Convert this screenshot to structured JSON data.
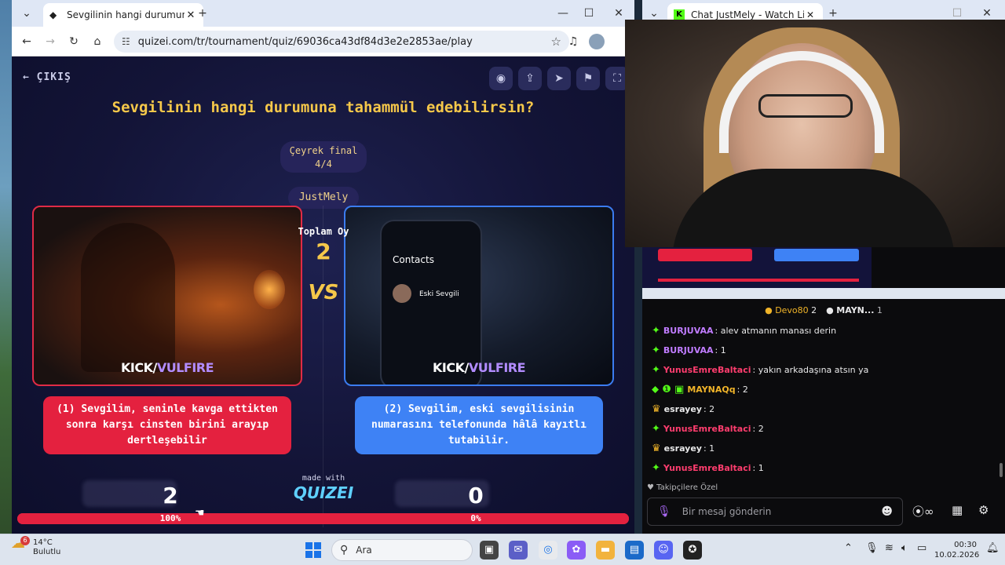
{
  "left_browser": {
    "tab_title": "Sevgilinin hangi durumuna taha",
    "new_tab": "+",
    "url": "quizei.com/tr/tournament/quiz/69036ca43df84d3e2e2853ae/play",
    "window_controls": {
      "min": "—",
      "max": "☐",
      "close": "✕"
    }
  },
  "quiz": {
    "exit_label": "ÇIKIŞ",
    "title": "Sevgilinin hangi durumuna tahammül edebilirsin?",
    "round_name": "Çeyrek final",
    "round_progress": "4/4",
    "player": "JustMely",
    "total_votes_label": "Toplam Oy",
    "total_votes": "2",
    "vs": "VS",
    "left_option": {
      "text": "(1) Sevgilim, seninle kavga ettikten sonra karşı cinsten birini arayıp dertleşebilir",
      "score": "2",
      "percent": "100%",
      "watermark_a": "KICK/",
      "watermark_b": "VULFIRE"
    },
    "right_option": {
      "text": "(2) Sevgilim, eski sevgilisinin numarasını telefonunda hâlâ kayıtlı tutabilir.",
      "score": "0",
      "percent": "0%",
      "watermark_a": "KICK/",
      "watermark_b": "VULFIRE",
      "phone_title": "Contacts",
      "phone_contact": "Eski Sevgili"
    },
    "made_with": "made with",
    "brand": "QUIZEI",
    "left_share": 1.0
  },
  "right_browser": {
    "tab_title": "Chat JustMely - Watch Live on",
    "new_tab": "+",
    "window_controls": {
      "min": "—",
      "max": "☐",
      "close": "✕"
    }
  },
  "chat": {
    "pinned": [
      {
        "user": "Devo80",
        "count": "2"
      },
      {
        "user": "MAYN...",
        "count": "1"
      }
    ],
    "messages": [
      {
        "user": "BURJUVAA",
        "text": ": alev atmanın manası derin",
        "color": "#c07cff",
        "badge": "✦"
      },
      {
        "user": "BURJUVAA",
        "text": ": 1",
        "color": "#c07cff",
        "badge": "✦"
      },
      {
        "user": "YunusEmreBaltaci",
        "text": ": yakın arkadaşına atsın ya",
        "color": "#ff3d6e",
        "badge": "✦"
      },
      {
        "user": "MAYNAQq",
        "text": ": 2",
        "color": "#f0b429",
        "badge": "⬥ ❶ ▣"
      },
      {
        "user": "esrayey",
        "text": ": 2",
        "color": "#e9e9ea",
        "badge": "♛"
      },
      {
        "user": "YunusEmreBaltaci",
        "text": ": 2",
        "color": "#ff3d6e",
        "badge": "✦"
      },
      {
        "user": "esrayey",
        "text": ": 1",
        "color": "#e9e9ea",
        "badge": "♛"
      },
      {
        "user": "YunusEmreBaltaci",
        "text": ": 1",
        "color": "#ff3d6e",
        "badge": "✦"
      }
    ],
    "followers_only": "Takipçilere Özel",
    "input_placeholder": "Bir mesaj gönderin"
  },
  "taskbar": {
    "temperature": "14°C",
    "weather": "Bulutlu",
    "weather_badge": "6",
    "search_label": "Ara",
    "time": "00:30",
    "date": "10.02.2026"
  },
  "colors": {
    "accent_yellow": "#f6c84a",
    "option_red": "#e4213f",
    "option_blue": "#3e82f5",
    "kick_green": "#53fc18"
  }
}
